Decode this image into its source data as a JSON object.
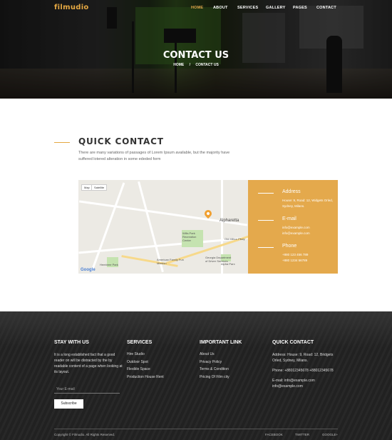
{
  "header": {
    "logo": "filmudio",
    "nav": [
      "HOME",
      "ABOUT",
      "SERVICES",
      "GALLERY",
      "PAGES",
      "CONTACT"
    ],
    "title": "CONTACT US",
    "breadcrumb": [
      "HOME",
      "/",
      "CONTACT US"
    ]
  },
  "quick_contact": {
    "title": "QUICK CONTACT",
    "text": "There are many variations of passages of Lorem Ipsum available, but the majority have suffered lotered alteration in some ededed form"
  },
  "map": {
    "map_button": "Map",
    "satellite_button": "Satellite",
    "city": "Alpharetta",
    "labels": [
      "Wills Park Recreation Center",
      "Old Milton Pkwy",
      "Hembree Park",
      "Alpha Parx",
      "Georgia Department of Driver Services",
      "American Family Fun Mission"
    ],
    "google": "Google"
  },
  "info": {
    "address_head": "Address",
    "address_val": "House: 9, Road: 12, Widgets Orled, Sydney, Milans.",
    "email_head": "E-mail",
    "email_val_1": "info@example.com",
    "email_val_2": "info@example.com",
    "phone_head": "Phone",
    "phone_val_1": "+880 123 456 789",
    "phone_val_2": "+880 1234 56789"
  },
  "footer": {
    "stay": {
      "title": "STAY WITH US",
      "text": "It is a long established fact that a good reader on will be distracted by the by readable content of a page when looking at its layout.",
      "email_placeholder": "Your E-mail",
      "subscribe": "Subscribe"
    },
    "services": {
      "title": "SERVICES",
      "links": [
        "Hire Studio",
        "Outdoor Spot",
        "Flexible Space",
        "Production House Rent"
      ]
    },
    "important": {
      "title": "IMPORTANT LINK",
      "links": [
        "About Us",
        "Privacy Policy",
        "Terms & Condition",
        "Pricing Of Film city"
      ]
    },
    "quick": {
      "title": "QUICK CONTACT",
      "address": "Address: House: 9, Road: 12, Bridgets Orled, Sydney, Milans.",
      "phone": "Phone: +88012345678 +88012345678",
      "email_1": "E-mail: info@example.com",
      "email_2": "info@example.com"
    },
    "copyright": "Copyright © Filmudio. All Rights Reserved.",
    "social": [
      "FACEBOOK",
      "TWITTER",
      "GOOGLE+"
    ]
  },
  "colors": {
    "accent": "#e4a94c",
    "footer_bg": "#232323"
  }
}
